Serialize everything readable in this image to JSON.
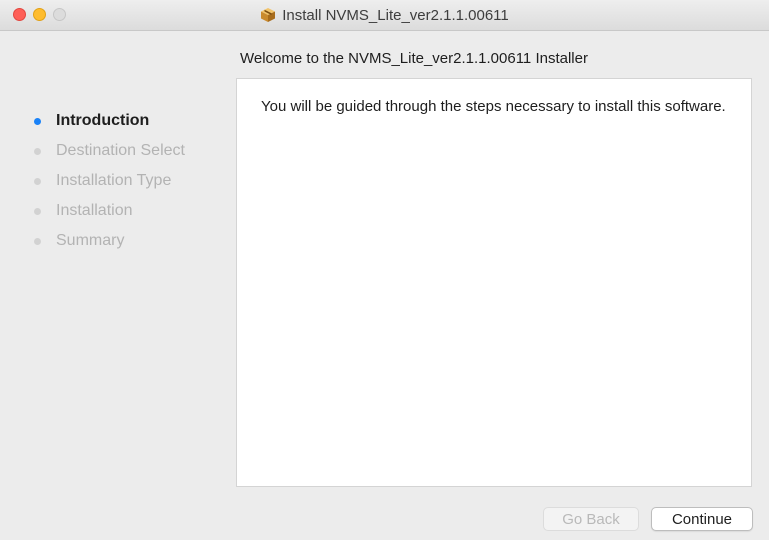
{
  "window": {
    "title": "Install NVMS_Lite_ver2.1.1.00611",
    "title_icon": "package-icon"
  },
  "header": {
    "title": "Welcome to the NVMS_Lite_ver2.1.1.00611 Installer"
  },
  "sidebar": {
    "steps": [
      {
        "label": "Introduction",
        "active": true
      },
      {
        "label": "Destination Select",
        "active": false
      },
      {
        "label": "Installation Type",
        "active": false
      },
      {
        "label": "Installation",
        "active": false
      },
      {
        "label": "Summary",
        "active": false
      }
    ]
  },
  "content": {
    "text": "You will be guided through the steps necessary to install this software."
  },
  "buttons": {
    "back_label": "Go Back",
    "back_enabled": false,
    "continue_label": "Continue"
  },
  "colors": {
    "active_step_dot": "#1a82f7",
    "close": "#fe5f57",
    "minimize": "#febc2e"
  }
}
